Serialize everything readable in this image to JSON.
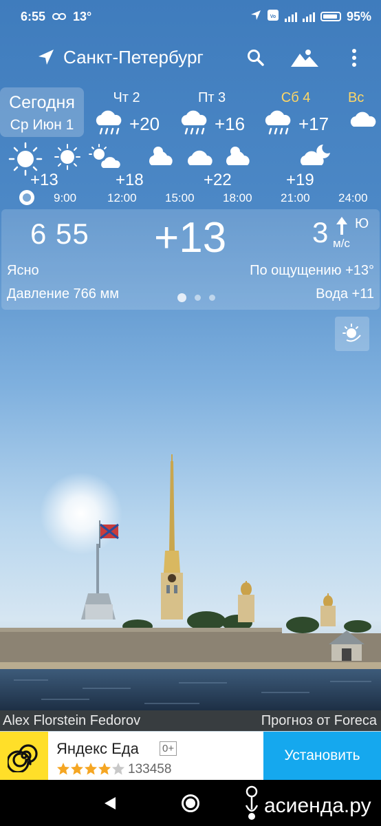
{
  "status_bar": {
    "time": "6:55",
    "temperature": "13°",
    "battery": "95%"
  },
  "header": {
    "city": "Санкт-Петербург"
  },
  "days": {
    "today": {
      "label": "Сегодня",
      "date": "Ср Июн 1"
    },
    "list": [
      {
        "name": "Чт 2",
        "temp": "+20",
        "icon": "rain-cloud-icon"
      },
      {
        "name": "Пт 3",
        "temp": "+16",
        "icon": "rain-cloud-icon"
      },
      {
        "name": "Сб 4",
        "temp": "+17",
        "icon": "rain-cloud-icon"
      },
      {
        "name": "Вс",
        "temp": "",
        "icon": "cloud-icon"
      }
    ]
  },
  "hourly": {
    "temps": [
      "+13",
      "+18",
      "+22",
      "+19"
    ],
    "times": [
      "9:00",
      "12:00",
      "15:00",
      "18:00",
      "21:00",
      "24:00"
    ],
    "icons": [
      "sun-icon",
      "sun-icon",
      "sun-cloud-icon",
      "partly-cloudy-icon",
      "cloud-icon",
      "partly-cloudy-icon",
      "night-cloud-icon"
    ]
  },
  "current": {
    "clock": "6 55",
    "temp": "+13",
    "wind_speed": "3",
    "wind_unit": "м/с",
    "wind_dir": "Ю",
    "condition": "Ясно",
    "feels_like": "По ощущению +13°",
    "pressure": "Давление 766 мм",
    "water": "Вода +11",
    "page": 1,
    "pages": 3
  },
  "credits": {
    "photo": "Alex Florstein Fedorov",
    "forecast": "Прогноз от Foreca"
  },
  "ad": {
    "title": "Яндекс Еда",
    "age": "0+",
    "rating_stars": 4,
    "rating_count": "133458",
    "button": "Установить"
  },
  "watermark": "асиенда.ру",
  "colors": {
    "sky_top": "#3f7cbd",
    "accent_saturday": "#ffd766",
    "ad_button": "#15a8ee",
    "ad_logo_bg": "#ffdf29"
  }
}
